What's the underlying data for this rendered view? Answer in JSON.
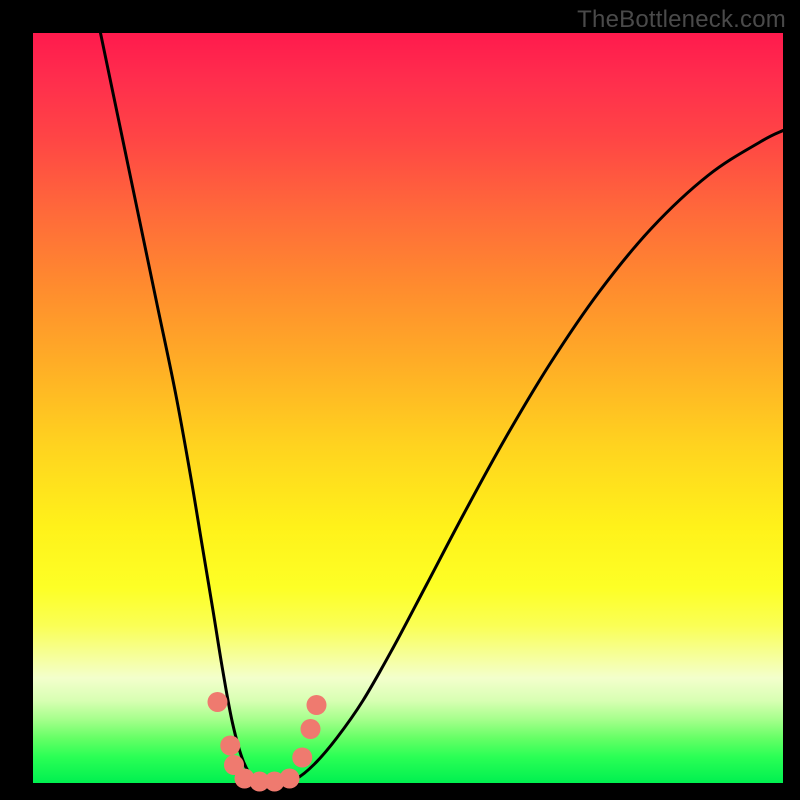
{
  "watermark": "TheBottleneck.com",
  "chart_data": {
    "type": "line",
    "title": "",
    "xlabel": "",
    "ylabel": "",
    "xlim": [
      0,
      1
    ],
    "ylim": [
      0,
      1
    ],
    "series": [
      {
        "name": "bottleneck-curve",
        "x": [
          0.09,
          0.115,
          0.14,
          0.165,
          0.19,
          0.21,
          0.225,
          0.24,
          0.253,
          0.266,
          0.28,
          0.295,
          0.31,
          0.33,
          0.35,
          0.375,
          0.405,
          0.44,
          0.48,
          0.525,
          0.575,
          0.63,
          0.69,
          0.755,
          0.825,
          0.9,
          0.97,
          1.0
        ],
        "y": [
          1.0,
          0.88,
          0.76,
          0.64,
          0.52,
          0.41,
          0.32,
          0.23,
          0.15,
          0.08,
          0.03,
          0.005,
          0.0,
          0.0,
          0.005,
          0.025,
          0.06,
          0.11,
          0.18,
          0.265,
          0.36,
          0.46,
          0.56,
          0.655,
          0.74,
          0.81,
          0.855,
          0.87
        ]
      }
    ],
    "markers": {
      "name": "highlight-dots",
      "color": "#ef7a6f",
      "points": [
        {
          "x": 0.246,
          "y": 0.108,
          "r": 10
        },
        {
          "x": 0.263,
          "y": 0.05,
          "r": 10
        },
        {
          "x": 0.268,
          "y": 0.024,
          "r": 10
        },
        {
          "x": 0.282,
          "y": 0.006,
          "r": 10
        },
        {
          "x": 0.302,
          "y": 0.002,
          "r": 10
        },
        {
          "x": 0.322,
          "y": 0.002,
          "r": 10
        },
        {
          "x": 0.342,
          "y": 0.006,
          "r": 10
        },
        {
          "x": 0.359,
          "y": 0.034,
          "r": 10
        },
        {
          "x": 0.37,
          "y": 0.072,
          "r": 10
        },
        {
          "x": 0.378,
          "y": 0.104,
          "r": 10
        }
      ]
    }
  }
}
